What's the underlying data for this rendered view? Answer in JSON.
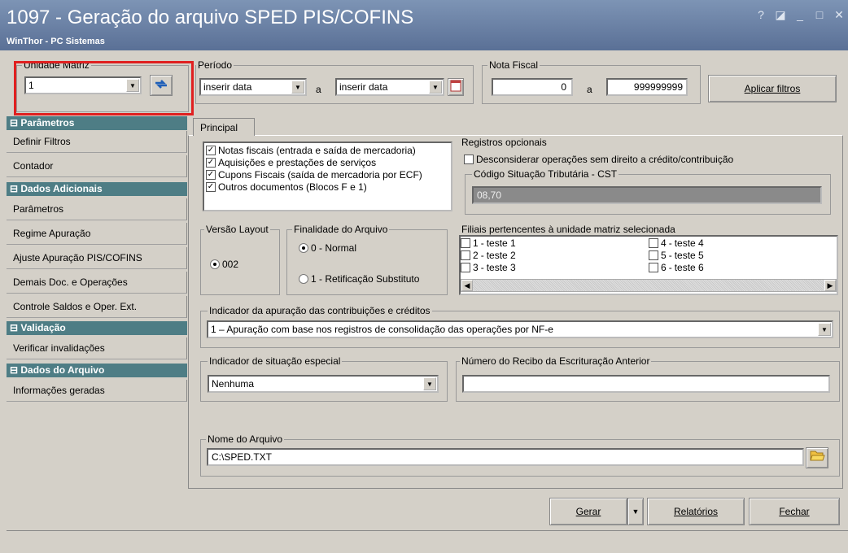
{
  "window": {
    "title": "1097 - Geração do arquivo SPED PIS/COFINS",
    "subtitle": "WinThor - PC Sistemas",
    "controls": [
      "?",
      "◪",
      "_",
      "□",
      "✕"
    ]
  },
  "filters": {
    "unidade_matriz": {
      "label": "Unidade Matriz",
      "value": "1"
    },
    "periodo": {
      "label": "Período",
      "from": "inserir data",
      "separator": "a",
      "to": "inserir data"
    },
    "nota_fiscal": {
      "label": "Nota Fiscal",
      "from": "0",
      "separator": "a",
      "to": "999999999"
    },
    "apply_button": "Aplicar filtros"
  },
  "sidebar": {
    "sections": [
      {
        "title": "Parâmetros",
        "items": [
          "Definir Filtros",
          "Contador"
        ]
      },
      {
        "title": "Dados Adicionais",
        "items": [
          "Parâmetros",
          "Regime Apuração",
          "Ajuste Apuração PIS/COFINS",
          "Demais Doc. e Operações",
          "Controle Saldos e Oper. Ext."
        ]
      },
      {
        "title": "Validação",
        "items": [
          "Verificar invalidações"
        ]
      },
      {
        "title": "Dados do Arquivo",
        "items": [
          "Informações geradas"
        ]
      }
    ]
  },
  "tabs": {
    "principal": "Principal"
  },
  "documents": {
    "items": [
      {
        "label": "Notas fiscais (entrada e saída de mercadoria)",
        "checked": true
      },
      {
        "label": "Aquisições e prestações de serviços",
        "checked": true
      },
      {
        "label": "Cupons Fiscais (saída de mercadoria por ECF)",
        "checked": true
      },
      {
        "label": "Outros documentos (Blocos F e 1)",
        "checked": true
      }
    ]
  },
  "registros_opcionais": {
    "label": "Registros opcionais",
    "desconsiderar": {
      "label": "Desconsiderar operações sem direito a crédito/contribuição",
      "checked": false
    },
    "cst": {
      "label": "Código Situação Tributária - CST",
      "value": "08,70"
    }
  },
  "versao_layout": {
    "label": "Versão Layout",
    "option": "002"
  },
  "finalidade": {
    "label": "Finalidade do Arquivo",
    "options": [
      {
        "label": "0 - Normal",
        "selected": true
      },
      {
        "label": "1 - Retificação Substituto",
        "selected": false
      }
    ]
  },
  "filiais": {
    "label": "Filiais pertencentes à unidade matriz selecionada",
    "items": [
      {
        "num": "1",
        "name": "teste 1"
      },
      {
        "num": "2",
        "name": "teste 2"
      },
      {
        "num": "3",
        "name": "teste 3"
      },
      {
        "num": "4",
        "name": "teste 4"
      },
      {
        "num": "5",
        "name": "teste 5"
      },
      {
        "num": "6",
        "name": "teste 6"
      }
    ]
  },
  "indicador_apuracao": {
    "label": "Indicador da apuração das contribuições e créditos",
    "value": "1 – Apuração com base nos registros de consolidação das operações por NF-e"
  },
  "situacao_especial": {
    "label": "Indicador de situação especial",
    "value": "Nenhuma"
  },
  "recibo": {
    "label": "Número do Recibo da Escrituração Anterior",
    "value": ""
  },
  "arquivo": {
    "label": "Nome do Arquivo",
    "value": "C:\\SPED.TXT"
  },
  "footer": {
    "gerar": "Gerar",
    "relatorios": "Relatórios",
    "fechar": "Fechar"
  }
}
